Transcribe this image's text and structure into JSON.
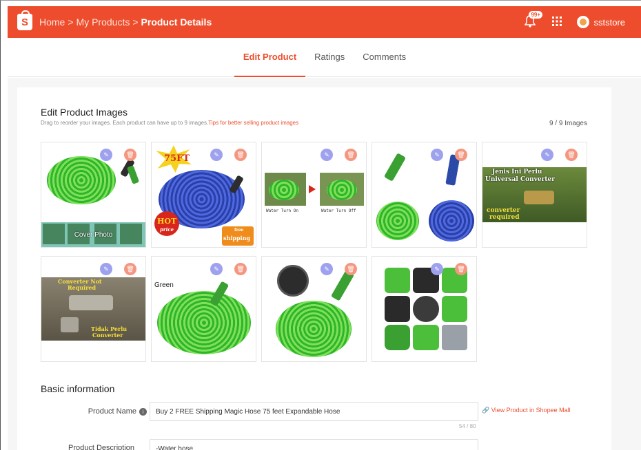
{
  "header": {
    "breadcrumb": [
      "Home",
      "My Products",
      "Product Details"
    ],
    "notification_badge": "99+",
    "username": "sststore",
    "brand_color": "#ee4d2d"
  },
  "tabs": [
    {
      "label": "Edit Product",
      "active": true
    },
    {
      "label": "Ratings",
      "active": false
    },
    {
      "label": "Comments",
      "active": false
    }
  ],
  "images_section": {
    "title": "Edit Product Images",
    "subtitle": "Drag to reorder your images. Each product can have up to 9 images.",
    "tips_link": "Tips for better selling product images",
    "count": "9 / 9 Images",
    "cover_label": "Cover Photo",
    "images": [
      {
        "captions": []
      },
      {
        "captions": [
          "75FT",
          "HOT",
          "price",
          "free",
          "shipping"
        ]
      },
      {
        "captions": [
          "Water Turn On",
          "Water Turn Off"
        ]
      },
      {
        "captions": []
      },
      {
        "captions": [
          "Jenis Ini Perlu",
          "Universal Converter",
          "converter",
          "required"
        ]
      },
      {
        "captions": [
          "Converter Not",
          "Required",
          "Tidak Perlu",
          "Converter"
        ]
      },
      {
        "captions": [
          "Green"
        ]
      },
      {
        "captions": []
      },
      {
        "captions": []
      }
    ]
  },
  "basic_info": {
    "title": "Basic information",
    "product_name_label": "Product Name",
    "product_name_value": "Buy 2 FREE Shipping Magic Hose 75 feet Expandable Hose",
    "product_name_counter": "54 / 80",
    "view_link": "View Product in Shopee Mall",
    "description_label": "Product Description",
    "description_value": "-Water hose"
  }
}
